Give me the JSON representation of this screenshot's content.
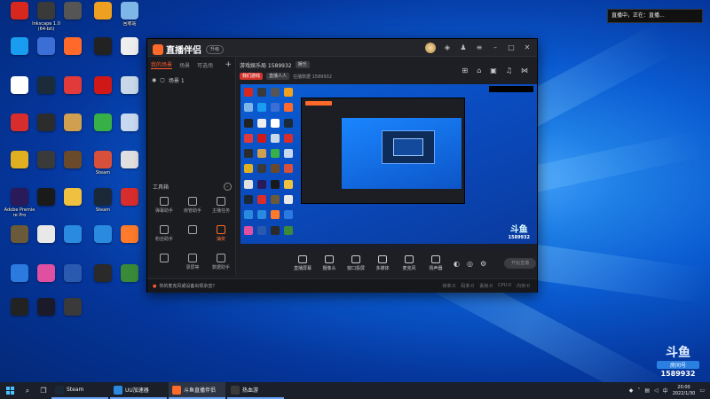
{
  "desktop": {
    "icons": [
      {
        "label": "",
        "color": "#d8281e"
      },
      {
        "label": "Inkscape 1.0 (64-bit)",
        "color": "#3a3a3a"
      },
      {
        "label": "",
        "color": "#555"
      },
      {
        "label": "",
        "color": "#f0a020"
      },
      {
        "label": "回收站",
        "color": "#7fb6e8"
      },
      {
        "label": "",
        "color": "#1a9df0"
      },
      {
        "label": "",
        "color": "#3b6fd6"
      },
      {
        "label": "",
        "color": "#ff6a2a"
      },
      {
        "label": "",
        "color": "#222"
      },
      {
        "label": "",
        "color": "#eee"
      },
      {
        "label": "",
        "color": "#ffffff"
      },
      {
        "label": "",
        "color": "#1b2b3a"
      },
      {
        "label": "",
        "color": "#e23a3a"
      },
      {
        "label": "",
        "color": "#d01818"
      },
      {
        "label": "",
        "color": "#c8d8e8"
      },
      {
        "label": "",
        "color": "#d82d2d"
      },
      {
        "label": "",
        "color": "#2c2c2c"
      },
      {
        "label": "",
        "color": "#d0a050"
      },
      {
        "label": "",
        "color": "#38b048"
      },
      {
        "label": "",
        "color": "#c8d8f0"
      },
      {
        "label": "",
        "color": "#e0b020"
      },
      {
        "label": "",
        "color": "#3a3a3a"
      },
      {
        "label": "",
        "color": "#6a4a2a"
      },
      {
        "label": "Steam",
        "color": "#d8503a"
      },
      {
        "label": "",
        "color": "#e0e0e0"
      },
      {
        "label": "Adobe Premiere Pro",
        "color": "#2a1a5a"
      },
      {
        "label": "",
        "color": "#1a1a1a"
      },
      {
        "label": "",
        "color": "#f0c040"
      },
      {
        "label": "Steam",
        "color": "#1b2838"
      },
      {
        "label": "",
        "color": "#d82d2d"
      },
      {
        "label": "",
        "color": "#6a5a3a"
      },
      {
        "label": "",
        "color": "#e8e8e8"
      },
      {
        "label": "",
        "color": "#2a8ae0"
      },
      {
        "label": "",
        "color": "#2a8ae0"
      },
      {
        "label": "",
        "color": "#ff7a2a"
      },
      {
        "label": "",
        "color": "#2a7ae0"
      },
      {
        "label": "",
        "color": "#e050a0"
      },
      {
        "label": "",
        "color": "#2a5ab0"
      },
      {
        "label": "",
        "color": "#2a2a2a"
      },
      {
        "label": "",
        "color": "#3a8a3a"
      },
      {
        "label": "",
        "color": "#222"
      },
      {
        "label": "",
        "color": "#1a1a2a"
      },
      {
        "label": "",
        "color": "#3a3a3a"
      }
    ]
  },
  "notice": {
    "text": "直播中，正在：直播..."
  },
  "app": {
    "brand": "直播伴侣",
    "brand_badge": "升级",
    "tabs": [
      {
        "label": "我的场景",
        "active": true
      },
      {
        "label": "场景",
        "active": false
      },
      {
        "label": "可选场",
        "active": false
      }
    ],
    "scene": "场景 1",
    "tools_head": "工具箱",
    "tools": [
      {
        "label": "弹幕助手",
        "hot": false
      },
      {
        "label": "房管助手",
        "hot": false
      },
      {
        "label": "主播任务",
        "hot": false
      },
      {
        "label": "粉丝助手",
        "hot": false
      },
      {
        "label": "",
        "hot": false
      },
      {
        "label": "抽奖",
        "hot": true
      },
      {
        "label": "",
        "hot": false
      },
      {
        "label": "录屏等",
        "hot": false
      },
      {
        "label": "数据助手",
        "hot": false
      },
      {
        "label": "",
        "hot": false
      },
      {
        "label": "",
        "hot": false
      },
      {
        "label": "",
        "hot": false
      }
    ],
    "main_head": {
      "title": "游戏娱乐局 1589932",
      "chip": "娱乐",
      "tag_red": "我们游戏",
      "tag_gray": "直播人人",
      "extra": "在播数据 1589932"
    },
    "sub_head": "直播伴侣直播间 1589932",
    "toolbar": [
      {
        "label": "直播屏幕"
      },
      {
        "label": "摄像头"
      },
      {
        "label": "窗口投屏"
      },
      {
        "label": "多媒体"
      },
      {
        "label": "麦克风"
      },
      {
        "label": "扬声器"
      }
    ],
    "go_live": "开始直播",
    "status_left": "你的麦克风或设备出现杂音？",
    "status_right": [
      "帧率:0",
      "码率:0",
      "丢帧:0",
      "CPU:0",
      "内存:0"
    ]
  },
  "watermark": {
    "logo": "斗鱼",
    "sub": "房间号",
    "id": "1589932"
  },
  "taskbar": {
    "items": [
      {
        "label": "Steam",
        "color": "#1b2838"
      },
      {
        "label": "UU加速器",
        "color": "#2a8ae0"
      },
      {
        "label": "斗鱼直播伴侣",
        "color": "#ff6a2a"
      },
      {
        "label": "热血游",
        "color": "#3a3a3a"
      }
    ],
    "clock_time": "20:00",
    "clock_date": "2022/1/30"
  }
}
